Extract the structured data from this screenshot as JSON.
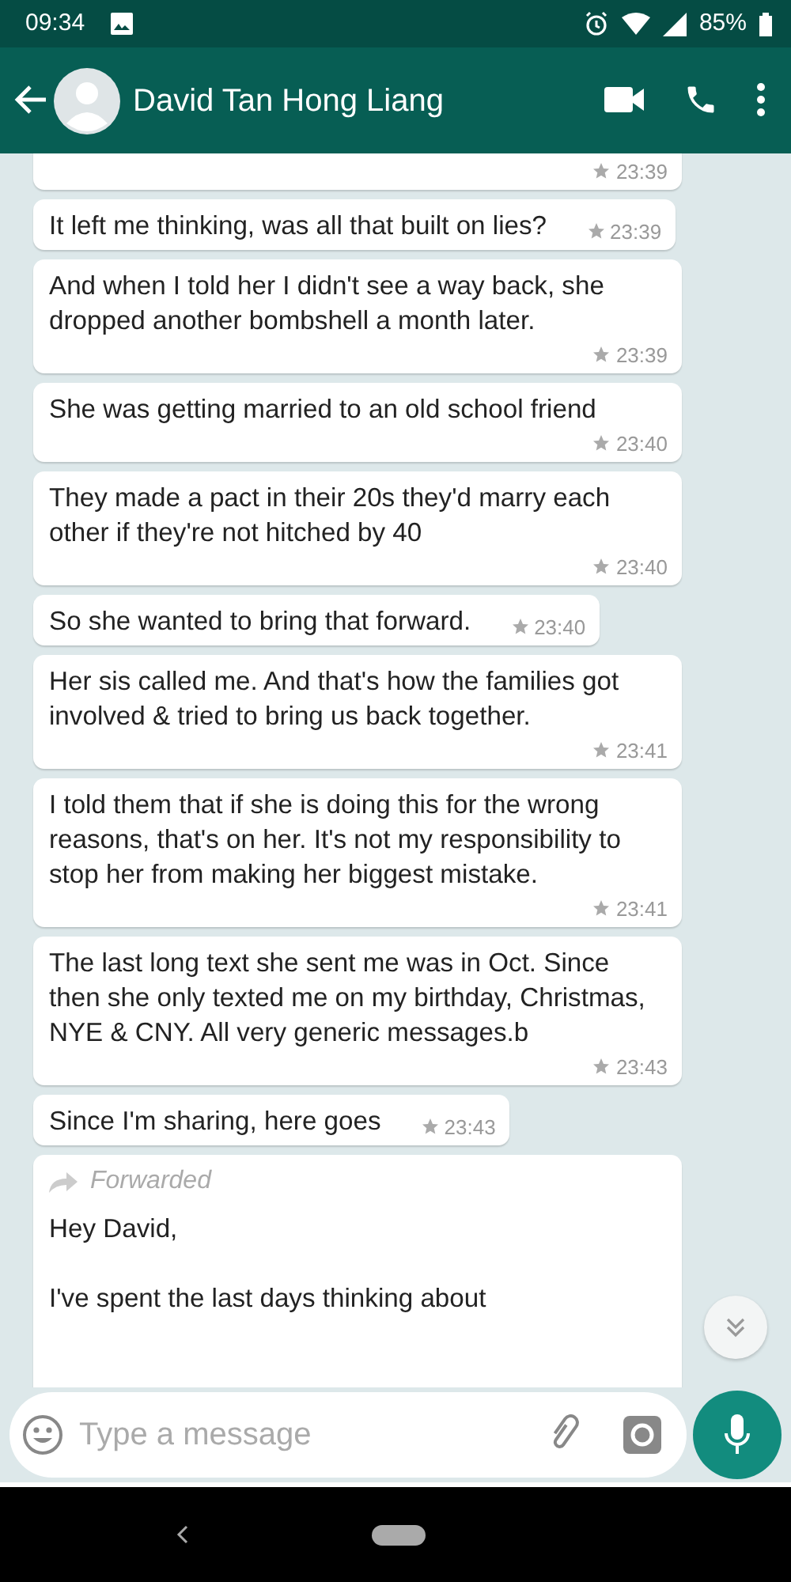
{
  "status_bar": {
    "time": "09:34",
    "battery": "85%"
  },
  "header": {
    "contact_name": "David Tan Hong Liang"
  },
  "messages": [
    {
      "time": "23:39",
      "starred": true
    },
    {
      "text": "It left me thinking, was all that built on lies?",
      "time": "23:39",
      "starred": true
    },
    {
      "text": "And when I told her I didn't see a way back, she dropped another bombshell a month later.",
      "time": "23:39",
      "starred": true
    },
    {
      "text": "She was getting married to an old school friend",
      "time": "23:40",
      "starred": true
    },
    {
      "text": "They made a pact in their 20s they'd marry each other if they're not hitched by 40",
      "time": "23:40",
      "starred": true
    },
    {
      "text": "So she wanted to bring that forward.",
      "time": "23:40",
      "starred": true
    },
    {
      "text": "Her sis called me. And that's how the families got involved & tried to bring us back together.",
      "time": "23:41",
      "starred": true
    },
    {
      "text": "I told them that if she is doing this for the wrong reasons, that's on her. It's not my responsibility to stop her from making her biggest mistake.",
      "time": "23:41",
      "starred": true
    },
    {
      "text": "The last long text she sent me was in Oct. Since then she only texted me on my birthday, Christmas, NYE & CNY. All very generic messages.b",
      "time": "23:43",
      "starred": true
    },
    {
      "text": "Since I'm sharing, here goes",
      "time": "23:43",
      "starred": true
    },
    {
      "forwarded_label": "Forwarded",
      "text": "Hey David,\n\nI've spent the last days thinking about"
    }
  ],
  "composer": {
    "placeholder": "Type a message"
  }
}
